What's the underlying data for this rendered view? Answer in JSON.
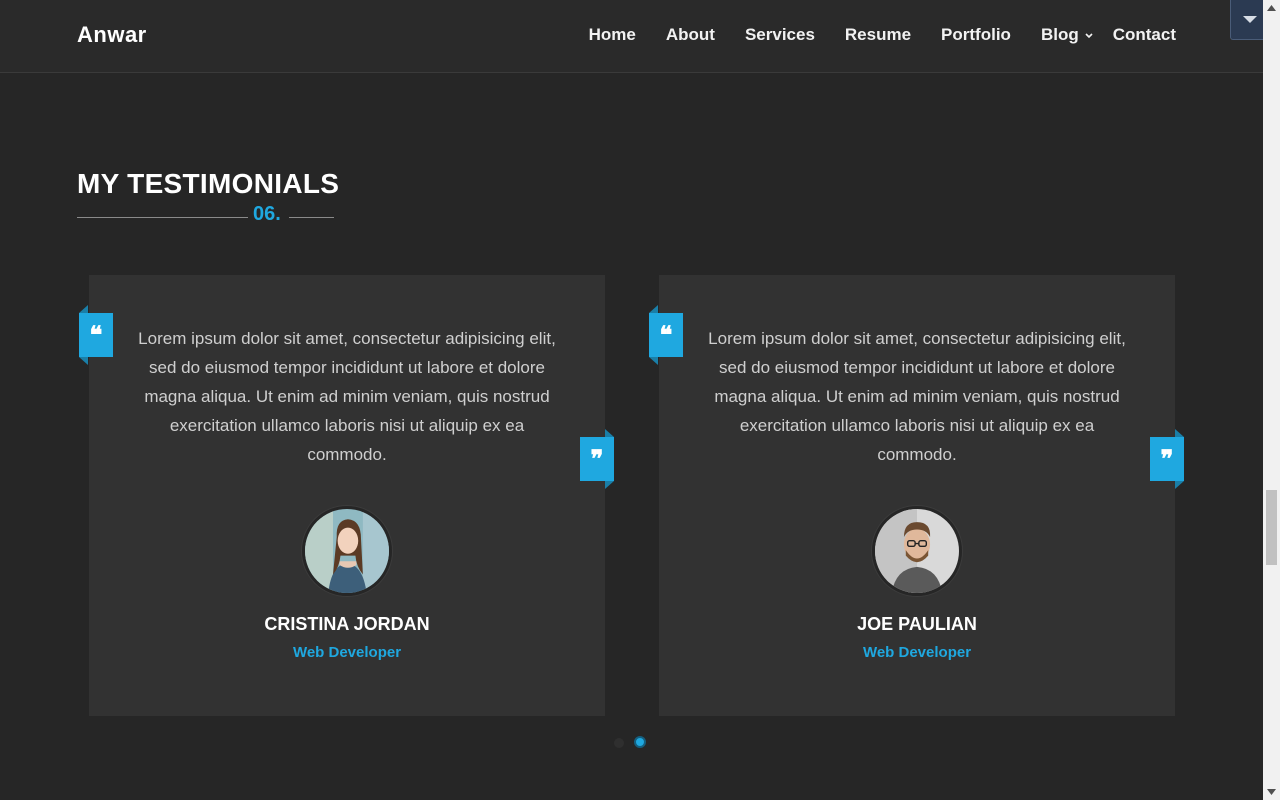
{
  "header": {
    "brand": "Anwar",
    "nav": {
      "home": "Home",
      "about": "About",
      "services": "Services",
      "resume": "Resume",
      "portfolio": "Portfolio",
      "blog": "Blog",
      "contact": "Contact"
    }
  },
  "section": {
    "title": "MY TESTIMONIALS",
    "number": "06."
  },
  "testimonials": [
    {
      "text": "Lorem ipsum dolor sit amet, consectetur adipisicing elit, sed do eiusmod tempor incididunt ut labore et dolore magna aliqua. Ut enim ad minim veniam, quis nostrud exercitation ullamco laboris nisi ut aliquip ex ea commodo.",
      "name": "CRISTINA JORDAN",
      "role": "Web Developer",
      "open_quote": "❝",
      "close_quote": "❞"
    },
    {
      "text": "Lorem ipsum dolor sit amet, consectetur adipisicing elit, sed do eiusmod tempor incididunt ut labore et dolore magna aliqua. Ut enim ad minim veniam, quis nostrud exercitation ullamco laboris nisi ut aliquip ex ea commodo.",
      "name": "JOE PAULIAN",
      "role": "Web Developer",
      "open_quote": "❝",
      "close_quote": "❞"
    }
  ],
  "carousel": {
    "page_count": 2,
    "active_page": 2
  },
  "colors": {
    "accent": "#1fa8e0",
    "background": "#262626",
    "card": "#323232"
  }
}
